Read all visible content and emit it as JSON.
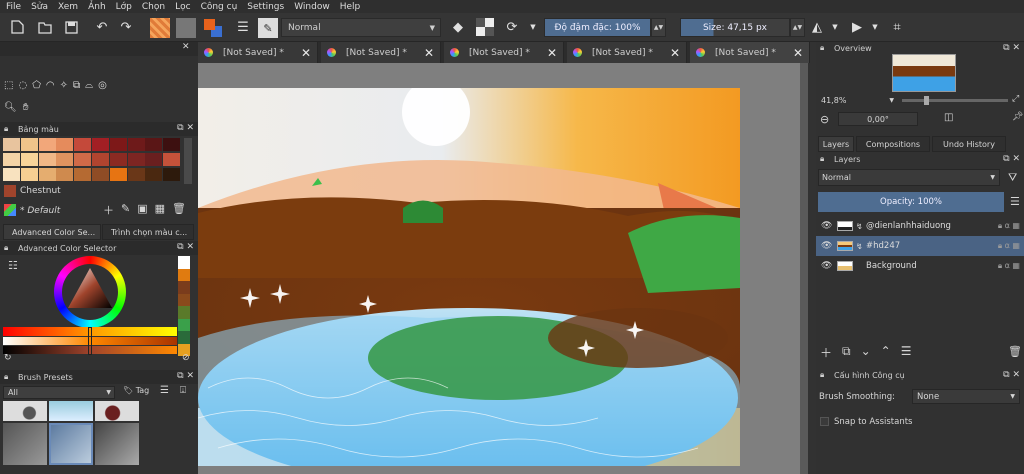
{
  "menu": [
    "File",
    "Sửa",
    "Xem",
    "Ảnh",
    "Lớp",
    "Chọn",
    "Lọc",
    "Công cụ",
    "Settings",
    "Window",
    "Help"
  ],
  "toolbar": {
    "blend_mode": "Normal",
    "opacity_label": "Độ đậm đặc: 100%",
    "size_label": "Size: 47,15 px"
  },
  "tabs": [
    {
      "label": "[Not Saved]  *"
    },
    {
      "label": "[Not Saved]  *"
    },
    {
      "label": "[Not Saved]  *"
    },
    {
      "label": "[Not Saved]  *"
    },
    {
      "label": "[Not Saved]  *"
    }
  ],
  "left": {
    "palette_title": "Bảng màu",
    "palette_colors": [
      [
        "#e8c49e",
        "#f0c48a",
        "#f2a77a",
        "#e58b5c",
        "#c4493a",
        "#a21f24",
        "#7d1818",
        "#6e1a1a",
        "#5a1616",
        "#3d1010"
      ],
      [
        "#f3d3a6",
        "#f7d49a",
        "#f0b787",
        "#e0935f",
        "#d06a48",
        "#b0442f",
        "#8b2a22",
        "#7d2522",
        "#6a1f1f",
        "#c4523a"
      ],
      [
        "#f8e2bf",
        "#f6cf92",
        "#e5ad6f",
        "#cf8a4e",
        "#b56a32",
        "#8f4c25",
        "#e77412",
        "#6a3718",
        "#4a2810",
        "#2d1a0c"
      ]
    ],
    "current_color_name": "Chestnut",
    "current_color_hex": "#a0442c",
    "palette_name": "* Default",
    "tabs": [
      "Advanced Color Se...",
      "Trình chọn màu c..."
    ],
    "color_selector_title": "Advanced Color Selector",
    "brush_presets_title": "Brush Presets",
    "brush_filter": "All",
    "brush_tag": "Tag"
  },
  "right": {
    "overview_title": "Overview",
    "zoom": "41,8%",
    "rotation": "0,00°",
    "tabs": [
      "Layers",
      "Compositions",
      "Undo History"
    ],
    "layers_title": "Layers",
    "blend_mode": "Normal",
    "opacity_label": "Opacity:  100%",
    "layers": [
      {
        "name": "@dienlanhhaiduong",
        "selected": false
      },
      {
        "name": "#hd247",
        "selected": true
      },
      {
        "name": "Background",
        "selected": false
      }
    ],
    "tool_options_title": "Cấu hình Công cụ",
    "brush_smoothing_label": "Brush Smoothing:",
    "brush_smoothing_value": "None",
    "snap_label": "Snap to Assistants"
  },
  "colors": {
    "accent_blue": "#4f6d91",
    "panel_bg": "#313131",
    "canvas_bg": "#7f7f7f"
  }
}
